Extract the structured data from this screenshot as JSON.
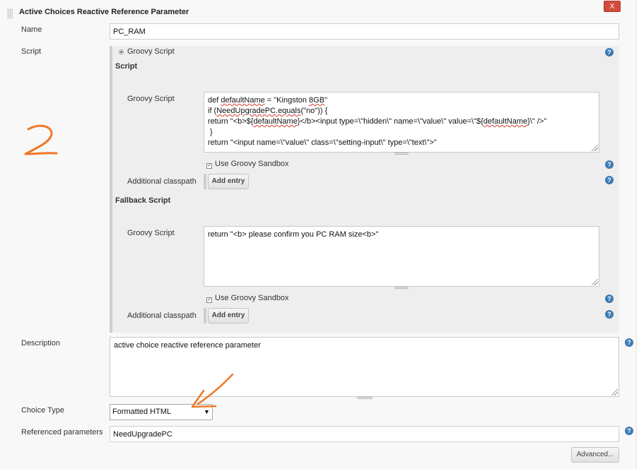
{
  "header": {
    "title": "Active Choices Reactive Reference Parameter",
    "close_label": "X"
  },
  "name_field": {
    "label": "Name",
    "value": "PC_RAM"
  },
  "script_section": {
    "label": "Script",
    "radio_label": "Groovy Script",
    "script_heading": "Script",
    "groovy_script": {
      "label": "Groovy Script",
      "lines": [
        "def defaultName = \"Kingston 8GB\"",
        "if (NeedUpgradePC.equals(\"no\")) {",
        "return \"<b>${defaultName}</b><input type=\\\"hidden\\\" name=\\\"value\\\" value=\\\"${defaultName}\\\" />\"",
        " }",
        "return \"<input name=\\\"value\\\" class=\\\"setting-input\\\" type=\\\"text\\\">\""
      ]
    },
    "sandbox_label": "Use Groovy Sandbox",
    "classpath_label": "Additional classpath",
    "add_entry_label": "Add entry",
    "fallback_heading": "Fallback Script",
    "fallback_script": {
      "label": "Groovy Script",
      "lines": [
        "return \"<b> please confirm you PC RAM size<b>\""
      ]
    },
    "fallback_sandbox_label": "Use Groovy Sandbox",
    "fallback_classpath_label": "Additional classpath",
    "fallback_add_entry_label": "Add entry"
  },
  "description": {
    "label": "Description",
    "value": "active choice reactive reference parameter"
  },
  "choice_type": {
    "label": "Choice Type",
    "selected": "Formatted HTML"
  },
  "referenced_parameters": {
    "label": "Referenced parameters",
    "value": "NeedUpgradePC"
  },
  "advanced_button": "Advanced...",
  "help_icon_glyph": "?",
  "annotation": {
    "text": "2",
    "color": "#f07828"
  }
}
